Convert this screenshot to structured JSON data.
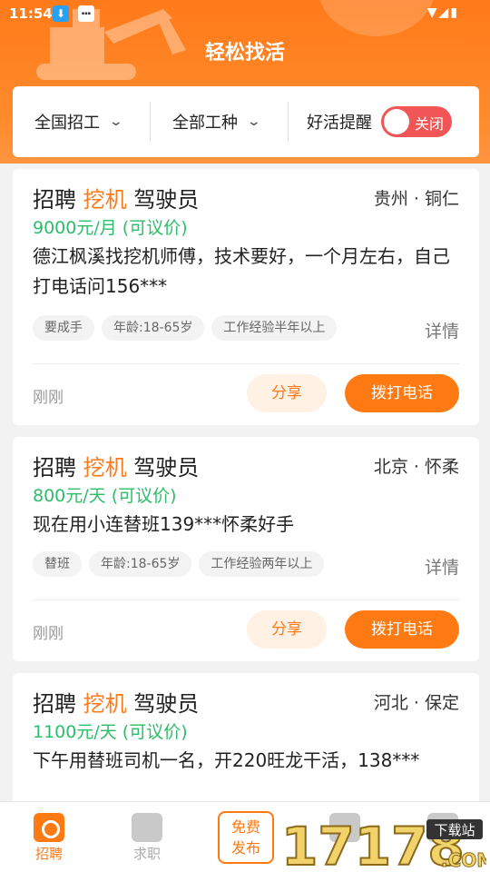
{
  "status_bar": {
    "time": "11:54"
  },
  "header": {
    "title": "轻松找活"
  },
  "filters": {
    "region": "全国招工",
    "job_type": "全部工种",
    "remind_label": "好活提醒",
    "remind_toggle": "关闭"
  },
  "jobs": [
    {
      "title_prefix": "招聘",
      "title_keyword": "挖机",
      "title_suffix": "驾驶员",
      "location": "贵州 · 铜仁",
      "salary": "9000元/月 (可议价)",
      "description": "德江枫溪找挖机师傅，技术要好，一个月左右，自己打电话问156***",
      "tags": [
        "要成手",
        "年龄:18-65岁",
        "工作经验半年以上"
      ],
      "detail": "详情",
      "time": "刚刚",
      "share": "分享",
      "call": "拨打电话"
    },
    {
      "title_prefix": "招聘",
      "title_keyword": "挖机",
      "title_suffix": "驾驶员",
      "location": "北京 · 怀柔",
      "salary": "800元/天 (可议价)",
      "description": "现在用小连替班139***怀柔好手",
      "tags": [
        "替班",
        "年龄:18-65岁",
        "工作经验两年以上"
      ],
      "detail": "详情",
      "time": "刚刚",
      "share": "分享",
      "call": "拨打电话"
    },
    {
      "title_prefix": "招聘",
      "title_keyword": "挖机",
      "title_suffix": "驾驶员",
      "location": "河北 · 保定",
      "salary": "1100元/天 (可议价)",
      "description": "下午用替班司机一名，开220旺龙干活，138***",
      "tags": [],
      "detail": "",
      "time": "",
      "share": "",
      "call": ""
    }
  ],
  "bottom_nav": {
    "recruit": "招聘",
    "job_seek": "求职",
    "publish_line1": "免费",
    "publish_line2": "发布"
  },
  "watermark": {
    "text": "17178",
    "sub": "下载站",
    "com": ".COM"
  },
  "colors": {
    "brand": "#ff7a12",
    "salary": "#2dbd6a",
    "toggle": "#f25555"
  }
}
